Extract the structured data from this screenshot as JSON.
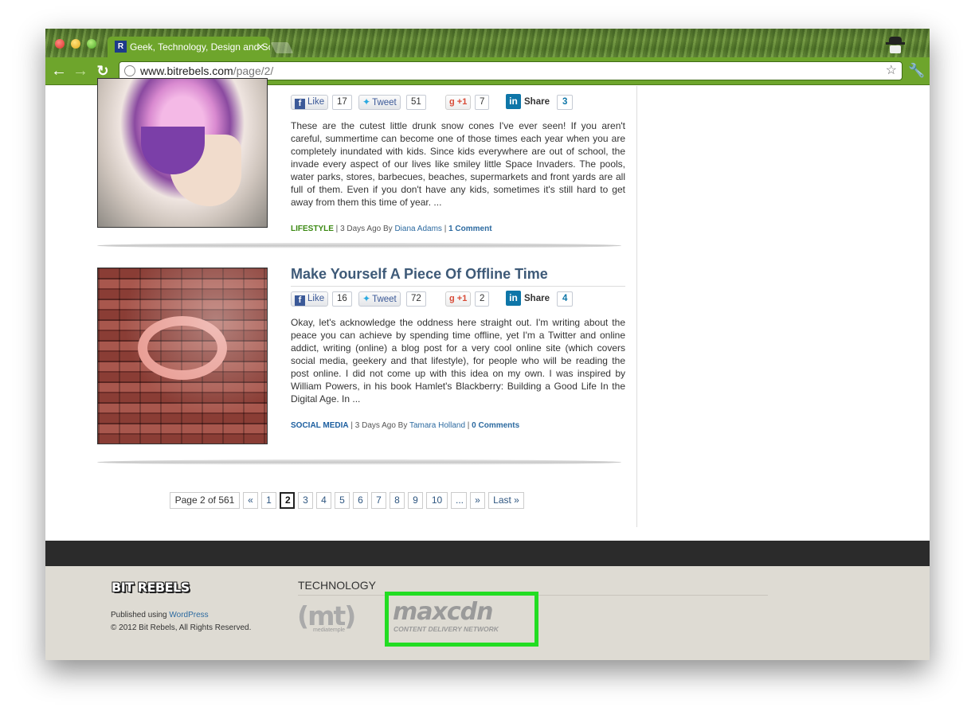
{
  "browser": {
    "tab_title": "Geek, Technology, Design and Social Media",
    "tab_favicon": "R",
    "tab_close": "×",
    "url_host": "www.bitrebels.com",
    "url_path": "/page/2/",
    "back_icon": "←",
    "forward_icon": "→",
    "reload_icon": "↻",
    "star_icon": "☆",
    "wrench_icon": "🔧"
  },
  "posts": [
    {
      "title": "",
      "social": {
        "like": "Like",
        "like_count": "17",
        "tweet": "Tweet",
        "tweet_count": "51",
        "gplus": "+1",
        "gplus_count": "7",
        "share": "Share",
        "share_count": "3"
      },
      "excerpt": "These are the cutest little drunk snow cones I've ever seen! If you aren't careful, summertime can become one of those times each year when you are completely inundated with kids. Since kids everywhere are out of school, the invade every aspect of our lives like smiley little Space Invaders. The pools, water parks, stores, barbecues, beaches, supermarkets and front yards are all full of them. Even if you don't have any kids, sometimes it's still hard to get away from them this time of year. ...",
      "category": "LIFESTYLE",
      "age": "3 Days Ago By",
      "author": "Diana Adams",
      "comments": "1 Comment"
    },
    {
      "title": "Make Yourself A Piece Of Offline Time",
      "social": {
        "like": "Like",
        "like_count": "16",
        "tweet": "Tweet",
        "tweet_count": "72",
        "gplus": "+1",
        "gplus_count": "2",
        "share": "Share",
        "share_count": "4"
      },
      "excerpt": "Okay, let's acknowledge the oddness here straight out. I'm writing about the peace you can achieve by spending time offline, yet I'm a Twitter and online addict, writing (online) a blog post for a very cool online site (which covers social media, geekery and that lifestyle), for people who will be reading the post online. I did not come up with this idea on my own. I was inspired by William Powers, in his book Hamlet's Blackberry: Building a Good Life In the Digital Age. In ...",
      "category": "SOCIAL MEDIA",
      "age": "3 Days Ago By",
      "author": "Tamara Holland",
      "comments": "0 Comments"
    }
  ],
  "pagination": {
    "info": "Page 2 of 561",
    "first": "«",
    "pages": [
      "1",
      "2",
      "3",
      "4",
      "5",
      "6",
      "7",
      "8",
      "9",
      "10"
    ],
    "current": "2",
    "ellipsis": "...",
    "next": "»",
    "last": "Last »"
  },
  "footer": {
    "brand": "BIT REBELS",
    "published_prefix": "Published using",
    "published_link": "WordPress",
    "copyright": "© 2012 Bit Rebels, All Rights Reserved.",
    "tech_heading": "TECHNOLOGY",
    "mt_logo": "(mt)",
    "mt_sub": "mediatemple",
    "maxcdn_logo": "maxcdn",
    "maxcdn_sub": "CONTENT DELIVERY NETWORK",
    "highlight_color": "#22dd22"
  }
}
